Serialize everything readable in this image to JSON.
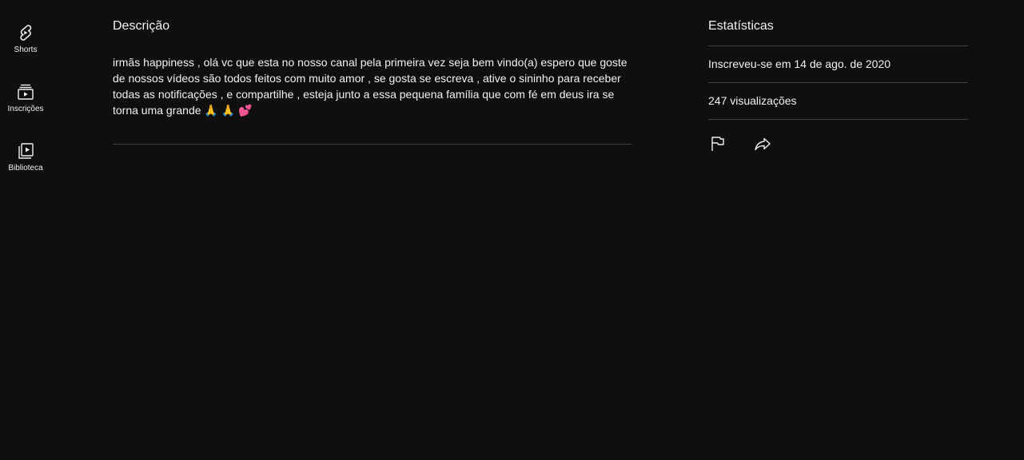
{
  "guide": {
    "items": [
      {
        "label": "Shorts",
        "icon": "shorts-icon"
      },
      {
        "label": "Inscrições",
        "icon": "subscriptions-icon"
      },
      {
        "label": "Biblioteca",
        "icon": "library-icon"
      }
    ]
  },
  "description": {
    "title": "Descrição",
    "text": "irmãs happiness , olá vc que esta no nosso canal pela primeira vez seja bem vindo(a) espero que goste de nossos vídeos são todos feitos com muito amor , se gosta se escreva , ative o sininho para receber todas as notificações , e compartilhe , esteja junto a essa pequena família que com fé em deus ira se torna uma grande 🙏 🙏 💕"
  },
  "stats": {
    "title": "Estatísticas",
    "joined": "Inscreveu-se em 14 de ago. de 2020",
    "views": "247 visualizações",
    "actions": {
      "report_icon": "flag-icon",
      "share_icon": "share-icon"
    }
  },
  "colors": {
    "background": "#0f0f0f",
    "text": "#f1f1f1",
    "divider": "#3f3f3f"
  }
}
